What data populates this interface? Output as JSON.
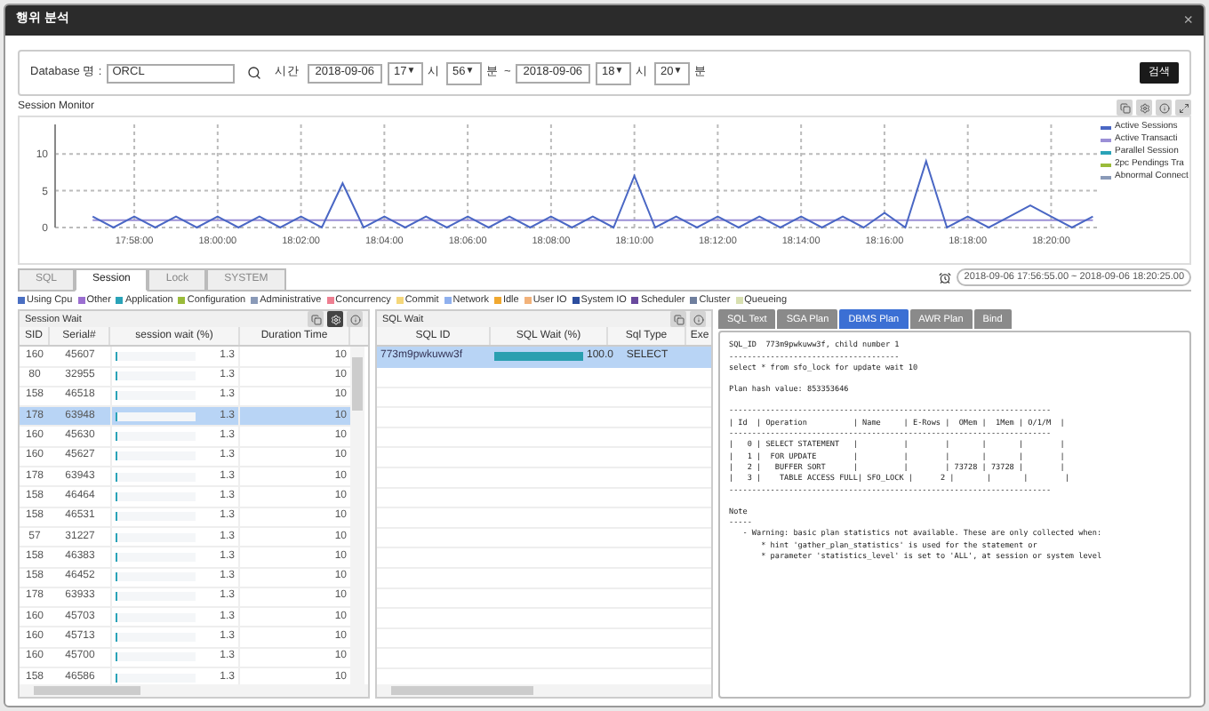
{
  "window": {
    "title": "행위 분석",
    "close": "×"
  },
  "search": {
    "db_label": "Database 명 :",
    "db_value": "ORCL",
    "time_label": "시간",
    "from_date": "2018-09-06",
    "from_hour": "17",
    "hour_unit": "시",
    "from_min": "56",
    "min_unit": "분",
    "tilde": "~",
    "to_date": "2018-09-06",
    "to_hour": "18",
    "to_hour_unit": "시",
    "to_min": "20",
    "to_min_unit": "분",
    "arrow": "▼",
    "button": "검색"
  },
  "monitor": {
    "title": "Session Monitor",
    "more_legend": [
      {
        "label": "Parallel Session",
        "color": "#2aa3b8"
      },
      {
        "label": "2pc Pendings Tra",
        "color": "#9abb3a"
      },
      {
        "label": "Abnormal Connect",
        "color": "#8a9ab8"
      }
    ],
    "chart_data": {
      "type": "line",
      "grid": true,
      "legend": "right",
      "categories": [
        null,
        null,
        "17:58:00",
        null,
        null,
        null,
        "18:00:00",
        null,
        null,
        null,
        "18:02:00",
        null,
        null,
        null,
        "18:04:00",
        null,
        null,
        null,
        "18:06:00",
        null,
        null,
        null,
        "18:08:00",
        null,
        null,
        null,
        "18:10:00",
        null,
        null,
        null,
        "18:12:00",
        null,
        null,
        null,
        "18:14:00",
        null,
        null,
        null,
        "18:16:00",
        null,
        null,
        null,
        "18:18:00",
        null,
        null,
        null,
        "18:20:00",
        null,
        null
      ],
      "series": [
        {
          "name": "Active Sessions",
          "color": "#4a67c4",
          "values": [
            1.5,
            0,
            1.5,
            0,
            1.5,
            0,
            1.5,
            0,
            1.5,
            0,
            1.5,
            0,
            6,
            0,
            1.5,
            0,
            1.5,
            0,
            1.5,
            0,
            1.5,
            0,
            1.5,
            0,
            1.5,
            0,
            7,
            0,
            1.5,
            0,
            1.5,
            0,
            1.5,
            0,
            1.5,
            0,
            1.5,
            0,
            2,
            0,
            9,
            0,
            1.5,
            0,
            1.5,
            3,
            1.5,
            0,
            1.5
          ]
        },
        {
          "name": "Active Transacti",
          "color": "#9b8fd6",
          "values": [
            1,
            1,
            1,
            1,
            1,
            1,
            1,
            1,
            1,
            1,
            1,
            1,
            1,
            1,
            1,
            1,
            1,
            1,
            1,
            1,
            1,
            1,
            1,
            1,
            1,
            1,
            1,
            1,
            1,
            1,
            1,
            1,
            1,
            1,
            1,
            1,
            1,
            1,
            1,
            1,
            1,
            1,
            1,
            1,
            1,
            1,
            1,
            1,
            1
          ]
        }
      ],
      "ylim": [
        0,
        14
      ],
      "yticks": [
        0,
        5,
        10
      ]
    }
  },
  "tabs": [
    {
      "label": "SQL",
      "selected": false
    },
    {
      "label": "Session",
      "selected": true
    },
    {
      "label": "Lock",
      "selected": false
    },
    {
      "label": "SYSTEM",
      "selected": false
    }
  ],
  "range": "2018-09-06 17:56:55.00 ~ 2018-09-06 18:20:25.00",
  "legend": [
    {
      "label": "Using Cpu",
      "color": "#4a6fc2"
    },
    {
      "label": "Other",
      "color": "#9b6fd1"
    },
    {
      "label": "Application",
      "color": "#2aa3b8"
    },
    {
      "label": "Configuration",
      "color": "#9abb3a"
    },
    {
      "label": "Administrative",
      "color": "#8a9ab8"
    },
    {
      "label": "Concurrency",
      "color": "#ee7f91"
    },
    {
      "label": "Commit",
      "color": "#f5d77a"
    },
    {
      "label": "Network",
      "color": "#8fb0ee"
    },
    {
      "label": "Idle",
      "color": "#f0a830"
    },
    {
      "label": "User IO",
      "color": "#f2b27a"
    },
    {
      "label": "System IO",
      "color": "#2d4e9e"
    },
    {
      "label": "Scheduler",
      "color": "#6a4a9e"
    },
    {
      "label": "Cluster",
      "color": "#6f7f9e"
    },
    {
      "label": "Queueing",
      "color": "#d8e0b0"
    }
  ],
  "session_wait": {
    "title": "Session Wait",
    "columns": [
      "SID",
      "Serial#",
      "session wait (%)",
      "Duration Time"
    ],
    "rows": [
      {
        "sid": "160",
        "serial": "45607",
        "level": 0.013,
        "wait": "1.3",
        "duration": "10",
        "selected": false
      },
      {
        "sid": "80",
        "serial": "32955",
        "level": 0.013,
        "wait": "1.3",
        "duration": "10",
        "selected": false
      },
      {
        "sid": "158",
        "serial": "46518",
        "level": 0.013,
        "wait": "1.3",
        "duration": "10",
        "selected": false
      },
      {
        "sid": "178",
        "serial": "63948",
        "level": 0.013,
        "wait": "1.3",
        "duration": "10",
        "selected": true
      },
      {
        "sid": "160",
        "serial": "45630",
        "level": 0.013,
        "wait": "1.3",
        "duration": "10",
        "selected": false
      },
      {
        "sid": "160",
        "serial": "45627",
        "level": 0.013,
        "wait": "1.3",
        "duration": "10",
        "selected": false
      },
      {
        "sid": "178",
        "serial": "63943",
        "level": 0.013,
        "wait": "1.3",
        "duration": "10",
        "selected": false
      },
      {
        "sid": "158",
        "serial": "46464",
        "level": 0.013,
        "wait": "1.3",
        "duration": "10",
        "selected": false
      },
      {
        "sid": "158",
        "serial": "46531",
        "level": 0.013,
        "wait": "1.3",
        "duration": "10",
        "selected": false
      },
      {
        "sid": "57",
        "serial": "31227",
        "level": 0.013,
        "wait": "1.3",
        "duration": "10",
        "selected": false
      },
      {
        "sid": "158",
        "serial": "46383",
        "level": 0.013,
        "wait": "1.3",
        "duration": "10",
        "selected": false
      },
      {
        "sid": "158",
        "serial": "46452",
        "level": 0.013,
        "wait": "1.3",
        "duration": "10",
        "selected": false
      },
      {
        "sid": "178",
        "serial": "63933",
        "level": 0.013,
        "wait": "1.3",
        "duration": "10",
        "selected": false
      },
      {
        "sid": "160",
        "serial": "45703",
        "level": 0.013,
        "wait": "1.3",
        "duration": "10",
        "selected": false
      },
      {
        "sid": "160",
        "serial": "45713",
        "level": 0.013,
        "wait": "1.3",
        "duration": "10",
        "selected": false
      },
      {
        "sid": "160",
        "serial": "45700",
        "level": 0.013,
        "wait": "1.3",
        "duration": "10",
        "selected": false
      },
      {
        "sid": "158",
        "serial": "46586",
        "level": 0.013,
        "wait": "1.3",
        "duration": "10",
        "selected": false
      }
    ]
  },
  "sql_wait": {
    "title": "SQL Wait",
    "columns": [
      "SQL ID",
      "SQL Wait (%)",
      "Sql Type",
      "Exe"
    ],
    "rows": [
      {
        "sql_id": "773m9pwkuww3f",
        "level": 1.0,
        "wait": "100.0",
        "type": "SELECT",
        "selected": true
      }
    ]
  },
  "plan_tabs": [
    {
      "label": "SQL Text",
      "selected": false
    },
    {
      "label": "SGA Plan",
      "selected": false
    },
    {
      "label": "DBMS Plan",
      "selected": true
    },
    {
      "label": "AWR Plan",
      "selected": false
    },
    {
      "label": "Bind",
      "selected": false
    }
  ],
  "plan_blocks": [
    [
      "SQL_ID  773m9pwkuww3f, child number 1",
      "-------------------------------------",
      "select * from sfo_lock for update wait 10"
    ],
    [
      "Plan hash value: 853353646"
    ],
    [
      "----------------------------------------------------------------------",
      "| Id  | Operation          | Name     | E-Rows |  OMem |  1Mem | O/1/M  |",
      "----------------------------------------------------------------------",
      "|   0 | SELECT STATEMENT   |          |        |       |       |        |",
      "|   1 |  FOR UPDATE        |          |        |       |       |        |",
      "|   2 |   BUFFER SORT      |          |        | 73728 | 73728 |        |",
      "|   3 |    TABLE ACCESS FULL| SFO_LOCK |      2 |       |       |        |",
      "----------------------------------------------------------------------"
    ],
    [
      "Note",
      "-----",
      "   - Warning: basic plan statistics not available. These are only collected when:",
      "       * hint 'gather_plan_statistics' is used for the statement or",
      "       * parameter 'statistics_level' is set to 'ALL', at session or system level"
    ]
  ]
}
